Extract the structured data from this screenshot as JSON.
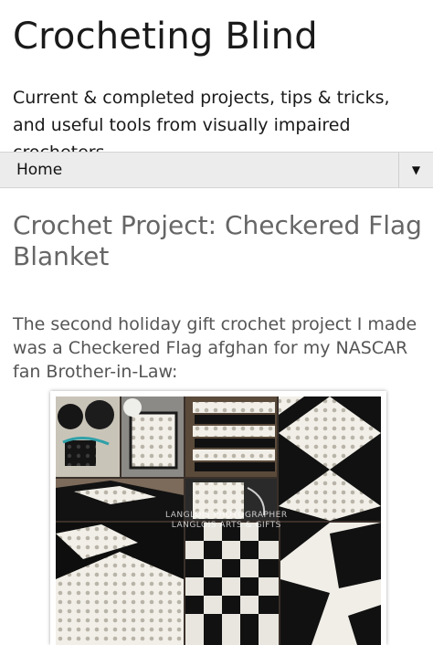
{
  "site": {
    "title": "Crocheting Blind",
    "description": "Current & completed projects, tips & tricks, and useful tools from visually impaired crocheters."
  },
  "nav": {
    "home_label": "Home",
    "toggle_icon": "dropdown-triangle-icon",
    "toggle_glyph": "▼"
  },
  "post": {
    "title": "Crochet Project: Checkered Flag Blanket",
    "intro": "The second holiday gift crochet project I made was a Checkered Flag afghan for my NASCAR fan Brother-in-Law:"
  },
  "image": {
    "watermark_line1": "LANGLOIS PHOTOGRAPHER",
    "watermark_line2": "LANGLOIS ARTS & GIFTS"
  },
  "colors": {
    "title_text": "#1a1a1a",
    "post_title": "#666666",
    "post_text": "#555555",
    "nav_bg": "#ececec"
  }
}
